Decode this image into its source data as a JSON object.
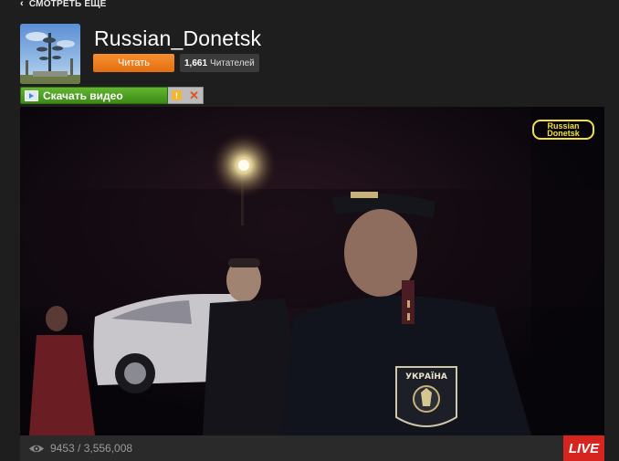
{
  "nav": {
    "back_label": "СМОТРЕТЬ ЕЩЕ"
  },
  "channel": {
    "name": "Russian_Donetsk",
    "follow_label": "Читать",
    "followers_count": "1,661",
    "followers_label": "Читателей"
  },
  "download": {
    "label": "Скачать видео"
  },
  "video": {
    "watermark_line1": "Russian",
    "watermark_line2": "Donetsk",
    "patch_text": "УКРАЇНА"
  },
  "stats": {
    "views": "9453 / 3,556,008",
    "live_label": "LIVE"
  },
  "colors": {
    "follow_button": "#e97c1c",
    "download_green": "#4a9e20",
    "live_red": "#d6251f",
    "watermark_yellow": "#f4e23a"
  },
  "icons": [
    "chevron-left-icon",
    "download-icon",
    "info-icon",
    "close-icon",
    "eye-icon"
  ]
}
